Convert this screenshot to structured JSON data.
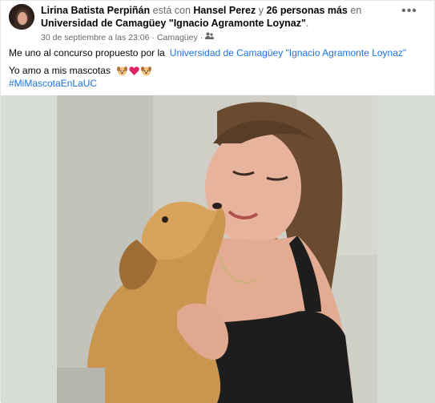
{
  "post": {
    "author": "Lirina Batista Perpiñán",
    "with_text": "está con",
    "tagged": "Hansel Perez",
    "and_text": "y",
    "others": "26 personas más",
    "at_text": "en",
    "place": "Universidad de Camagüey \"Ignacio Agramonte Loynaz\"",
    "period": ".",
    "date": "30 de septiembre a las 23:06",
    "separator": "·",
    "location": "Camagüey",
    "separator2": "·",
    "audience_icon": "friends-icon",
    "more_icon": "more-options-icon",
    "more_glyph": "•••"
  },
  "body": {
    "line1_text": "Me uno al concurso propuesto por la",
    "line1_link": "Universidad de Camagüey \"Ignacio Agramonte Loynaz\"",
    "line2_text": "Yo amo a mis mascotas",
    "line2_emojis": [
      "dog-face-emoji",
      "red-heart-emoji",
      "dog-face-emoji"
    ],
    "hashtag": "#MiMascotaEnLaUC"
  },
  "photo": {
    "subject": "photo-woman-kissing-dog"
  },
  "colors": {
    "link": "#1b74e4",
    "meta": "#65676b",
    "text": "#050505",
    "photo_bg": "#d7dcd6"
  }
}
